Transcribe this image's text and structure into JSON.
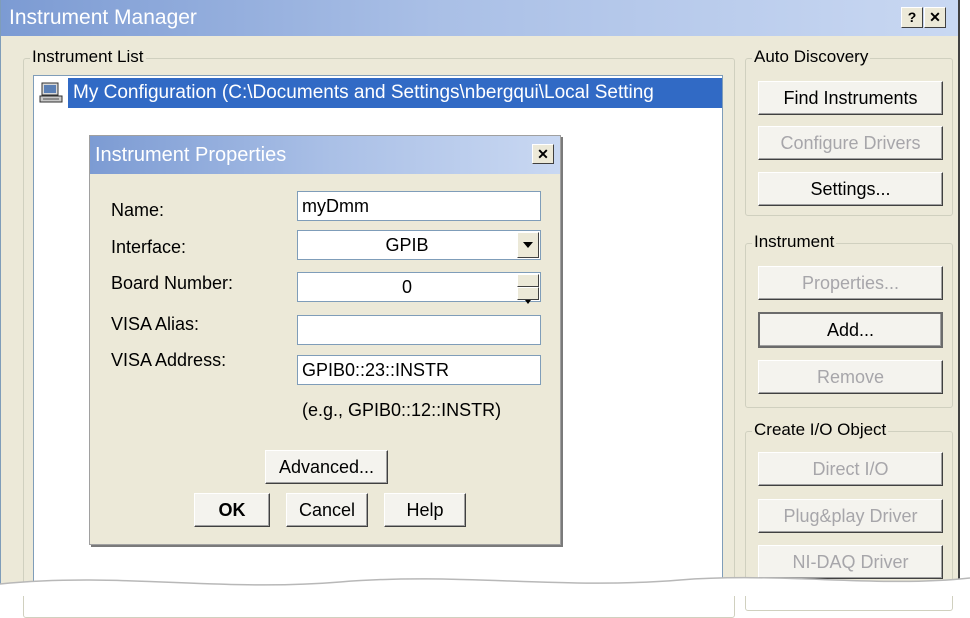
{
  "window": {
    "title": "Instrument Manager",
    "help_btn": "?",
    "close_btn": "✕"
  },
  "instrument_list": {
    "label": "Instrument List",
    "items": [
      {
        "label": "My Configuration (C:\\Documents and Settings\\nbergqui\\Local Setting"
      }
    ]
  },
  "auto_discovery": {
    "label": "Auto Discovery",
    "find_instruments": "Find Instruments",
    "configure_drivers": "Configure Drivers",
    "settings": "Settings..."
  },
  "instrument_group": {
    "label": "Instrument",
    "properties": "Properties...",
    "add": "Add...",
    "remove": "Remove"
  },
  "create_io": {
    "label": "Create I/O Object",
    "direct_io": "Direct I/O",
    "plugplay": "Plug&play Driver",
    "nidaq": "NI-DAQ Driver"
  },
  "dialog": {
    "title": "Instrument Properties",
    "close": "✕",
    "name_label": "Name:",
    "name_value": "myDmm",
    "interface_label": "Interface:",
    "interface_value": "GPIB",
    "board_label": "Board Number:",
    "board_value": "0",
    "alias_label": "VISA Alias:",
    "alias_value": "",
    "address_label": "VISA Address:",
    "address_value": "GPIB0::23::INSTR",
    "example_hint": "(e.g., GPIB0::12::INSTR)",
    "advanced": "Advanced...",
    "ok": "OK",
    "cancel": "Cancel",
    "help": "Help"
  }
}
